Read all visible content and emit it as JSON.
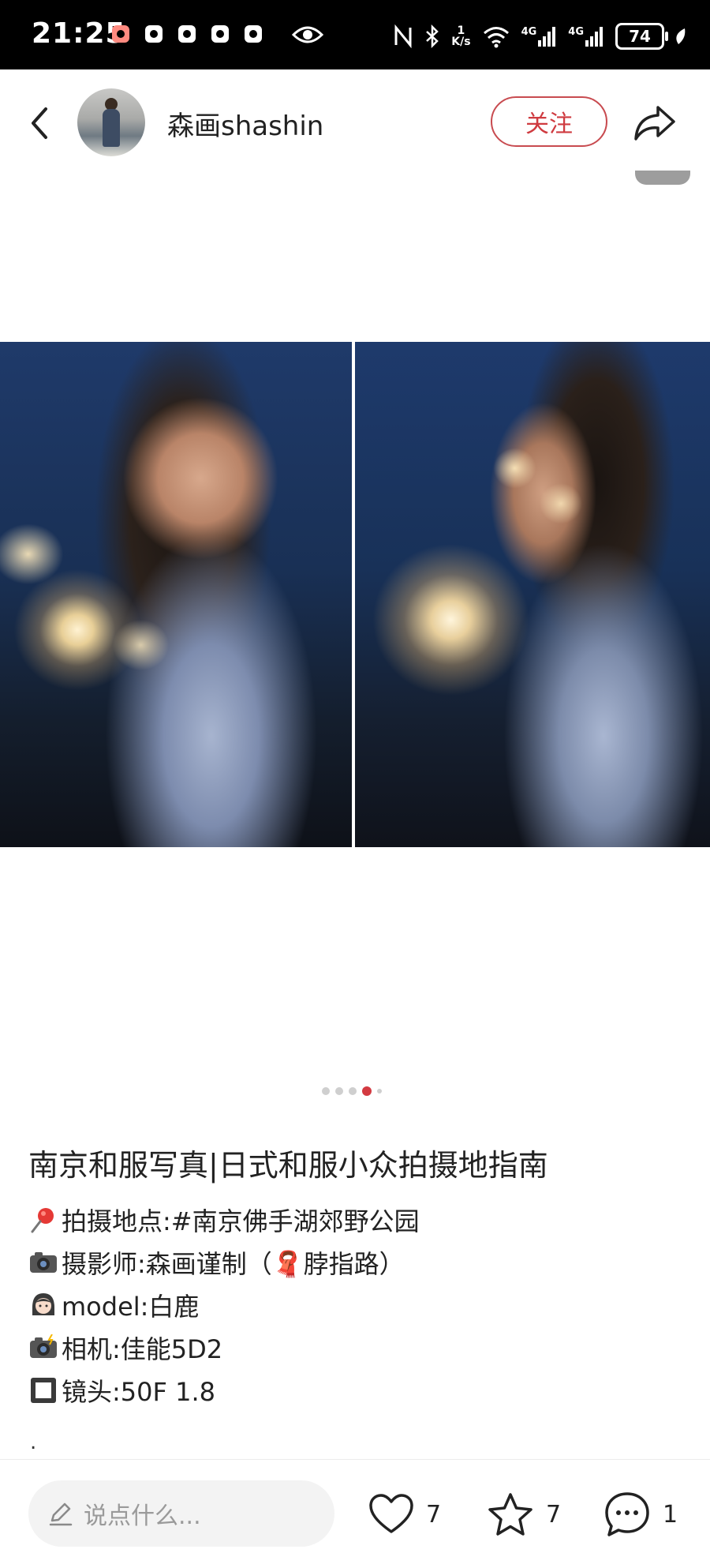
{
  "status_bar": {
    "time": "21:25",
    "speed_top": "1",
    "speed_unit": "K/s",
    "net_1": "4G",
    "net_2": "4G",
    "battery": "74"
  },
  "header": {
    "username": "森画shashin",
    "follow_label": "关注"
  },
  "carousel": {
    "total": 5,
    "current": 4
  },
  "post": {
    "title": "南京和服写真|日式和服小众拍摄地指南",
    "lines": [
      {
        "icon": "pushpin-icon",
        "text": "拍摄地点:#南京佛手湖郊野公园"
      },
      {
        "icon": "camera-icon",
        "text": "摄影师:森画谨制（🧣脖指路）"
      },
      {
        "icon": "girl-icon",
        "text": "model:白鹿"
      },
      {
        "icon": "camera-flash-icon",
        "text": "相机:佳能5D2"
      },
      {
        "icon": "square-button-icon",
        "text": "镜头:50F  1.8"
      }
    ],
    "trailing": "."
  },
  "bottom_bar": {
    "comment_placeholder": "说点什么...",
    "likes": "7",
    "favorites": "7",
    "comments": "1"
  },
  "colors": {
    "accent": "#cf3b40",
    "status_bar_bg": "#000000"
  }
}
